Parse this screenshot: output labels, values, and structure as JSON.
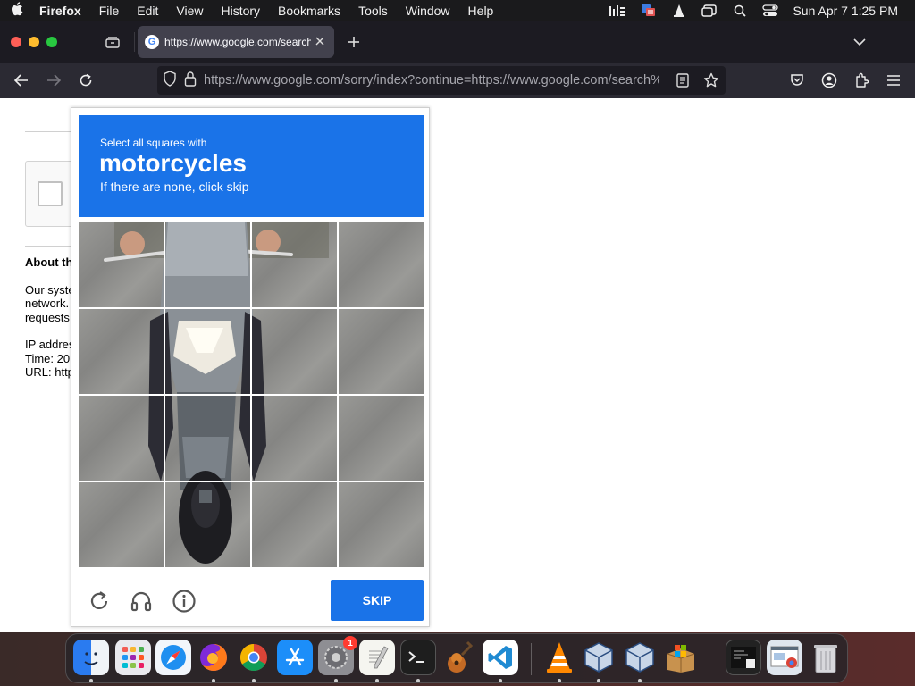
{
  "menubar": {
    "app_name": "Firefox",
    "menus": [
      "File",
      "Edit",
      "View",
      "History",
      "Bookmarks",
      "Tools",
      "Window",
      "Help"
    ],
    "clock": "Sun Apr 7  1:25 PM"
  },
  "tab": {
    "title": "https://www.google.com/search?q=",
    "favicon_letter": "G"
  },
  "toolbar": {
    "url": "https://www.google.com/sorry/index?continue=https://www.google.com/search%"
  },
  "page": {
    "about_heading": "About th",
    "lines": [
      "Our syste",
      "network.",
      "requests",
      "IP addres",
      "Time: 20",
      "URL: http"
    ]
  },
  "captcha": {
    "instruction_small": "Select all squares with",
    "target": "motorcycles",
    "hint": "If there are none, click skip",
    "skip_label": "SKIP",
    "accent": "#1a73e8"
  },
  "dock": {
    "settings_badge": "1"
  }
}
